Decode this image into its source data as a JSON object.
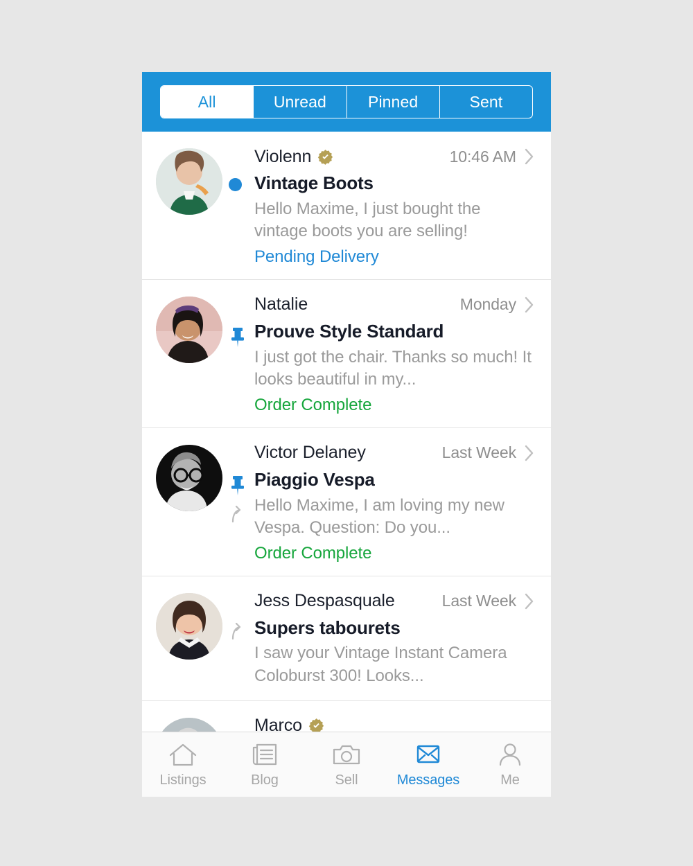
{
  "theme": {
    "accent_blue": "#1c92d8",
    "link_blue": "#2089d6",
    "status_green": "#16a63c",
    "verified_gold": "#b5a055",
    "page_background": "#e7e7e7",
    "muted_text": "#9a9a9a"
  },
  "segmented_control": {
    "selected": "All",
    "tabs": [
      {
        "label": "All",
        "active": true
      },
      {
        "label": "Unread",
        "active": false
      },
      {
        "label": "Pinned",
        "active": false
      },
      {
        "label": "Sent",
        "active": false
      }
    ]
  },
  "conversations": [
    {
      "sender": "Violenn",
      "verified": true,
      "time": "10:46 AM",
      "marker": "unread-dot",
      "subject": "Vintage Boots",
      "snippet": "Hello Maxime, I just bought the vintage boots you are selling!",
      "status": "Pending Delivery",
      "status_color": "blue"
    },
    {
      "sender": "Natalie",
      "verified": false,
      "time": "Monday",
      "marker": "pin",
      "subject": "Prouve Style Standard",
      "snippet": "I just got the chair. Thanks so much! It looks beautiful in my...",
      "status": "Order Complete",
      "status_color": "green"
    },
    {
      "sender": "Victor Delaney",
      "verified": false,
      "time": "Last Week",
      "marker": "pin",
      "marker_secondary": "reply-arrow",
      "subject": "Piaggio Vespa",
      "snippet": "Hello Maxime, I am loving my new Vespa. Question: Do you...",
      "status": "Order Complete",
      "status_color": "green"
    },
    {
      "sender": "Jess Despasquale",
      "verified": false,
      "time": "Last Week",
      "marker": "reply-arrow",
      "subject": "Supers tabourets",
      "snippet": "I saw your Vintage Instant Camera Coloburst 300! Looks...",
      "status": "",
      "status_color": ""
    },
    {
      "sender": "Marco",
      "verified": true,
      "time": "",
      "marker": "",
      "subject": "",
      "snippet": "",
      "status": "",
      "status_color": ""
    }
  ],
  "tabbar": {
    "items": [
      {
        "label": "Listings",
        "icon": "home-icon",
        "active": false
      },
      {
        "label": "Blog",
        "icon": "newspaper-icon",
        "active": false
      },
      {
        "label": "Sell",
        "icon": "camera-icon",
        "active": false
      },
      {
        "label": "Messages",
        "icon": "envelope-icon",
        "active": true
      },
      {
        "label": "Me",
        "icon": "person-icon",
        "active": false
      }
    ]
  }
}
